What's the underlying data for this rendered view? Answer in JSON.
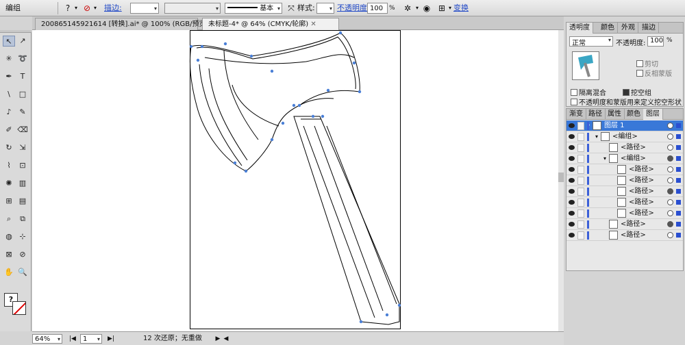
{
  "control_bar": {
    "object_type": "编组",
    "stroke_link": "描边:",
    "stroke_style_label": "基本",
    "style_label": "样式:",
    "opacity_link": "不透明度:",
    "opacity_value": "100",
    "opacity_unit": "%",
    "transform_link": "变换"
  },
  "document_tabs": [
    {
      "label": "200865145921614 [转换].ai* @ 100% (RGB/预览)",
      "active": false
    },
    {
      "label": "未标题-4* @ 64% (CMYK/轮廓)",
      "active": true
    }
  ],
  "status_bar": {
    "zoom": "64%",
    "page": "1",
    "undo_info": "12 次还原；无重做"
  },
  "transparency_panel": {
    "tabs": [
      "透明度",
      "颜色",
      "外观",
      "描边"
    ],
    "blend_mode": "正常",
    "opacity_label": "不透明度:",
    "opacity_value": "100",
    "opacity_unit": "%",
    "clip_label": "剪切",
    "invert_mask_label": "反相蒙版",
    "isolate_blending_label": "隔离混合",
    "knockout_group_label": "挖空组",
    "opacity_mask_label": "不透明度和蒙版用来定义挖空形状"
  },
  "layers_panel": {
    "tabs": [
      "渐变",
      "路径",
      "属性",
      "颜色",
      "图层"
    ],
    "rows": [
      {
        "label": "图层 1",
        "indent": 0,
        "selected": true
      },
      {
        "label": "<编组>",
        "indent": 1,
        "selected": false
      },
      {
        "label": "<路径>",
        "indent": 2,
        "selected": false
      },
      {
        "label": "<编组>",
        "indent": 2,
        "selected": false
      },
      {
        "label": "<路径>",
        "indent": 3,
        "selected": false
      },
      {
        "label": "<路径>",
        "indent": 3,
        "selected": false
      },
      {
        "label": "<路径>",
        "indent": 3,
        "selected": false
      },
      {
        "label": "<路径>",
        "indent": 3,
        "selected": false
      },
      {
        "label": "<路径>",
        "indent": 3,
        "selected": false
      },
      {
        "label": "<路径>",
        "indent": 2,
        "selected": false
      },
      {
        "label": "<路径>",
        "indent": 2,
        "selected": false
      }
    ]
  },
  "tools_icon_names": [
    "selection-tool",
    "direct-selection-tool",
    "magic-wand-tool",
    "lasso-tool",
    "pen-tool",
    "type-tool",
    "line-tool",
    "rectangle-tool",
    "paintbrush-tool",
    "pencil-tool",
    "blob-brush-tool",
    "eraser-tool",
    "rotate-tool",
    "scale-tool",
    "warp-tool",
    "free-transform-tool",
    "symbol-sprayer-tool",
    "column-graph-tool",
    "mesh-tool",
    "gradient-tool",
    "eyedropper-tool",
    "blend-tool",
    "live-paint-tool",
    "live-paint-select-tool",
    "crop-tool",
    "slice-tool",
    "hand-tool",
    "zoom-tool"
  ]
}
